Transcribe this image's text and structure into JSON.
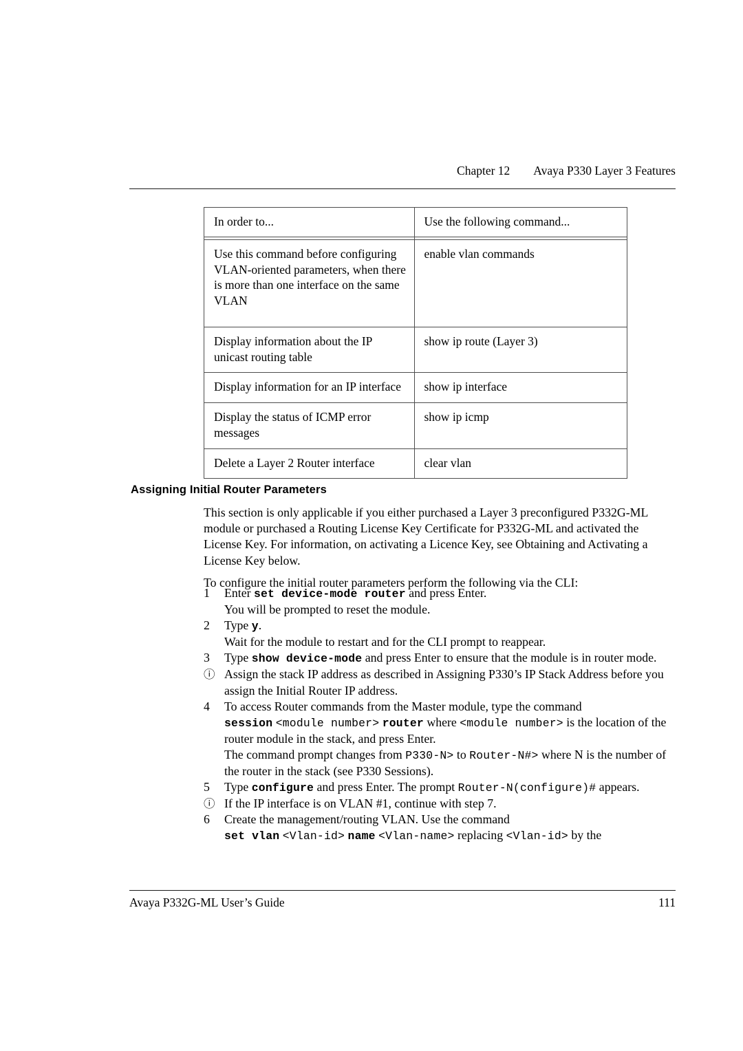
{
  "header": {
    "chapter": "Chapter 12",
    "title": "Avaya P330 Layer 3 Features"
  },
  "table": {
    "columns": [
      "In order to...",
      "Use the following command..."
    ],
    "rows": [
      {
        "task": "Use this command before configuring VLAN-oriented parameters, when there is more than one interface on the same VLAN",
        "command": "enable vlan commands"
      },
      {
        "task": "Display information about the IP unicast routing table",
        "command": "show ip route (Layer 3)"
      },
      {
        "task": "Display information for an IP interface",
        "command": "show ip interface"
      },
      {
        "task": "Display the status of ICMP error messages",
        "command": "show ip icmp"
      },
      {
        "task": "Delete a Layer 2 Router interface",
        "command": "clear vlan"
      }
    ]
  },
  "section": {
    "heading": "Assigning Initial Router Parameters",
    "paragraph1": "This section is only applicable if you either purchased a Layer 3 preconfigured P332G-ML module or purchased a Routing License Key Certificate for P332G-ML and activated the License Key. For information, on activating a Licence Key, see Obtaining and Activating a License Key below.",
    "paragraph2": "To configure the initial router parameters perform the following via the CLI:"
  },
  "steps": [
    {
      "marker": "1",
      "line1_pre": "Enter ",
      "line1_cmd": "set device-mode router",
      "line1_post": " and press Enter.",
      "line2": "You will be prompted to reset the module."
    },
    {
      "marker": "2",
      "line1_pre": "Type ",
      "line1_cmd": "y",
      "line1_post": ".",
      "line2": "Wait for the module to restart and for the CLI prompt to reappear."
    },
    {
      "marker": "3",
      "line1_pre": "Type ",
      "line1_cmd": "show device-mode",
      "line1_post": " and press Enter to ensure that the module is in router mode."
    },
    {
      "marker": "note-icon",
      "text": "Assign the stack IP address as described in Assigning P330’s IP Stack Address before you assign the Initial Router IP address."
    },
    {
      "marker": "4",
      "lead": "To access Router commands from the Master module, type the command",
      "cmd_session": "session",
      "arg_module": "<module number>",
      "cmd_router": "router",
      "mid": " where ",
      "arg_module2": "<module number>",
      "tail": " is the location of the router module in the stack, and press Enter.",
      "line3_pre": "The command prompt changes from ",
      "prompt_from": "P330-N>",
      "line3_mid": " to ",
      "prompt_to": "Router-N#>",
      "line3_post": " where N is the number of the router in the stack (see P330 Sessions)."
    },
    {
      "marker": "5",
      "pre": "Type ",
      "cmd": "configure",
      "mid": " and press Enter. The prompt ",
      "prompt": "Router-N(configure)#",
      "post": " appears."
    },
    {
      "marker": "note-icon",
      "text": "If the IP interface is on VLAN #1, continue with step 7."
    },
    {
      "marker": "6",
      "lead": "Create the management/routing VLAN. Use the command",
      "cmd_set_vlan": "set vlan",
      "arg_vlan_id": "<Vlan-id>",
      "cmd_name": "name",
      "arg_vlan_name": "<Vlan-name>",
      "mid": " replacing ",
      "arg_vlan_id2": "<Vlan-id>",
      "tail": " by the"
    }
  ],
  "footer": {
    "guide": "Avaya P332G-ML User’s Guide",
    "page_number": "111"
  },
  "icons": {
    "note": "ⓘ"
  }
}
